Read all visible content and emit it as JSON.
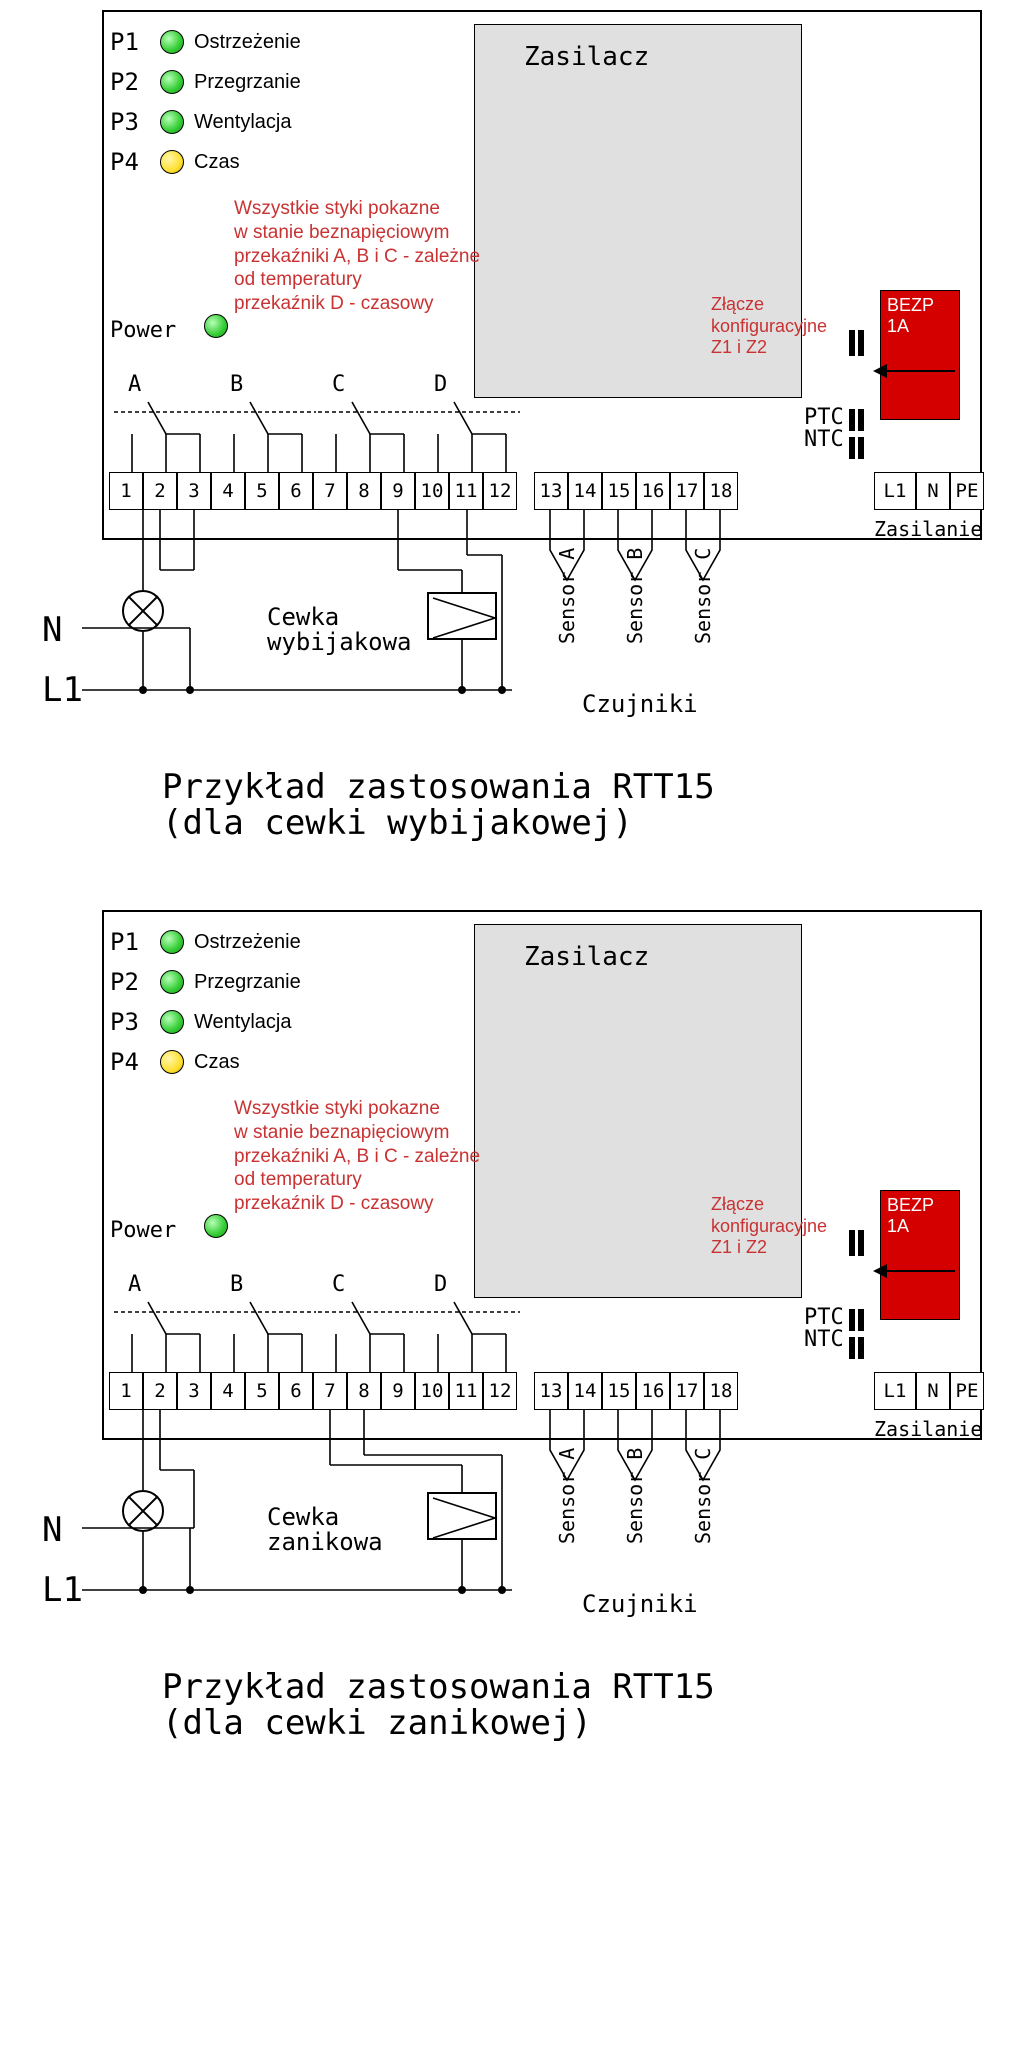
{
  "leds": [
    {
      "id": "P1",
      "label": "Ostrzeżenie",
      "color": "green"
    },
    {
      "id": "P2",
      "label": "Przegrzanie",
      "color": "green"
    },
    {
      "id": "P3",
      "label": "Wentylacja",
      "color": "green"
    },
    {
      "id": "P4",
      "label": "Czas",
      "color": "yellow"
    }
  ],
  "power_supply_label": "Zasilacz",
  "info_text": "Wszystkie styki pokazne\nw stanie beznapięciowym\nprzekaźniki A, B i C - zależne\nod temperatury\nprzekaźnik D - czasowy",
  "power_label": "Power",
  "config_label": "Złącze konfiguracyjne Z1 i Z2",
  "fuse": {
    "line1": "BEZP",
    "line2": "1A"
  },
  "ptc": "PTC",
  "ntc": "NTC",
  "relays": [
    "A",
    "B",
    "C",
    "D"
  ],
  "terminals_left": [
    "1",
    "2",
    "3",
    "4",
    "5",
    "6",
    "7",
    "8",
    "9",
    "10",
    "11",
    "12"
  ],
  "terminals_mid": [
    "13",
    "14",
    "15",
    "16",
    "17",
    "18"
  ],
  "terminals_right": [
    "L1",
    "N",
    "PE"
  ],
  "supply_label": "Zasilanie",
  "n_label": "N",
  "l1_label": "L1",
  "sensors": [
    "Sensor A",
    "Sensor B",
    "Sensor C"
  ],
  "sensors_label": "Czujniki",
  "diagrams": [
    {
      "coil_label": "Cewka\nwybijakowa",
      "title": "Przykład zastosowania RTT15\n(dla cewki wybijakowej)"
    },
    {
      "coil_label": "Cewka\nzanikowa",
      "title": "Przykład zastosowania RTT15\n(dla cewki zanikowej)"
    }
  ]
}
